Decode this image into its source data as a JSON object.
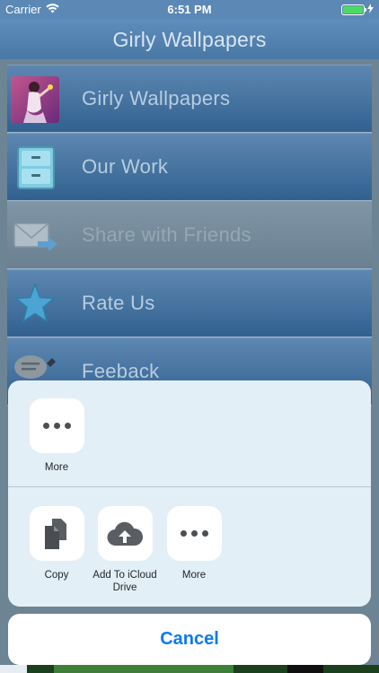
{
  "status_bar": {
    "carrier": "Carrier",
    "time": "6:51 PM",
    "wifi_icon": "wifi-icon",
    "battery_icon": "battery-icon",
    "battery_level": 1.0
  },
  "nav": {
    "title": "Girly Wallpapers"
  },
  "menu": {
    "items": [
      {
        "label": "Girly Wallpapers",
        "icon": "girl-wallpaper-thumbnail"
      },
      {
        "label": "Our Work",
        "icon": "cabinet-icon"
      },
      {
        "label": "Share with Friends",
        "icon": "envelope-arrow-icon"
      },
      {
        "label": "Rate Us",
        "icon": "star-icon"
      },
      {
        "label": "Feeback",
        "icon": "speech-bubble-pencil-icon"
      }
    ]
  },
  "share_sheet": {
    "row1": [
      {
        "label": "More",
        "icon": "more-icon"
      }
    ],
    "row2": [
      {
        "label": "Copy",
        "icon": "copy-icon"
      },
      {
        "label": "Add To iCloud Drive",
        "icon": "icloud-upload-icon"
      },
      {
        "label": "More",
        "icon": "more-icon"
      }
    ],
    "cancel_label": "Cancel"
  },
  "colors": {
    "accent": "#0a79f2",
    "menu_blue": "#3d6c9a",
    "sheet_bg": "#e3eff7"
  }
}
